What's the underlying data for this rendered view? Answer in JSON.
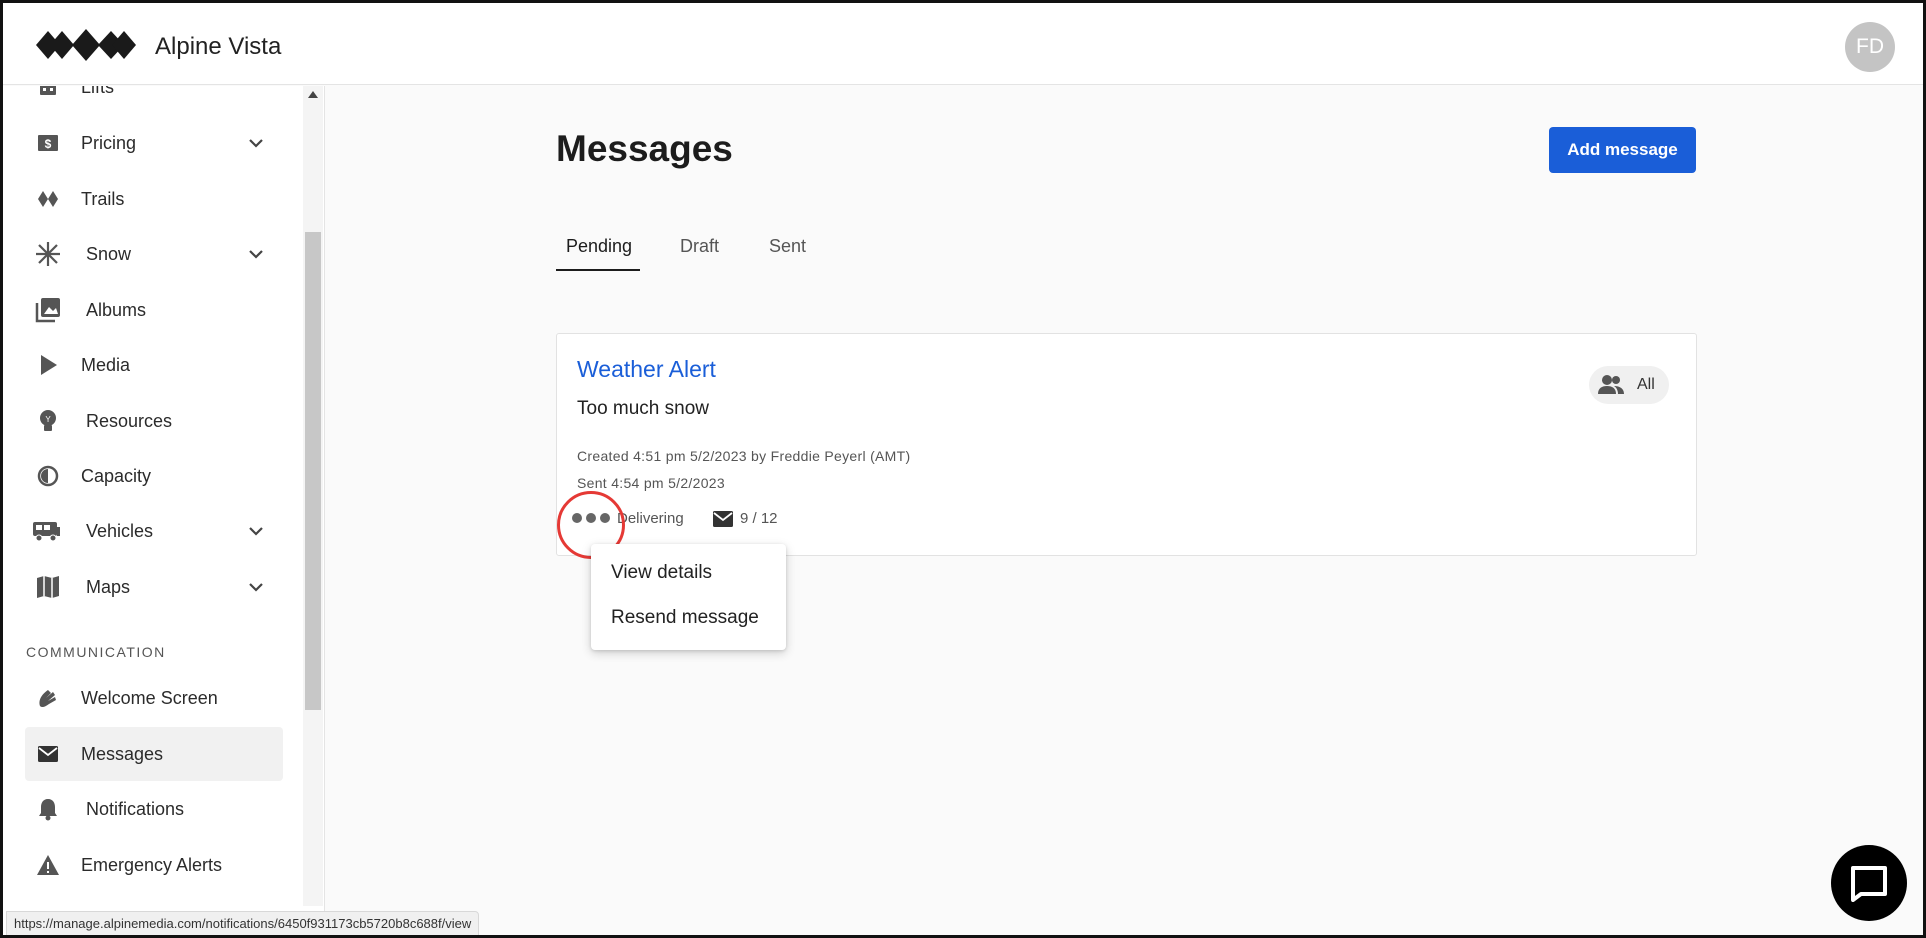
{
  "app": {
    "brand": "Alpine Vista",
    "avatar_initials": "FD"
  },
  "sidebar": {
    "items": [
      {
        "label": "Lifts",
        "icon": "lift-icon"
      },
      {
        "label": "Pricing",
        "icon": "dollar-icon",
        "expandable": true
      },
      {
        "label": "Trails",
        "icon": "trails-icon"
      },
      {
        "label": "Snow",
        "icon": "snowflake-icon",
        "expandable": true
      },
      {
        "label": "Albums",
        "icon": "photo-library-icon"
      },
      {
        "label": "Media",
        "icon": "play-icon"
      },
      {
        "label": "Resources",
        "icon": "lightbulb-icon"
      },
      {
        "label": "Capacity",
        "icon": "gauge-icon"
      },
      {
        "label": "Vehicles",
        "icon": "bus-icon",
        "expandable": true
      },
      {
        "label": "Maps",
        "icon": "map-icon",
        "expandable": true
      }
    ],
    "section_communication": "COMMUNICATION",
    "comm_items": [
      {
        "label": "Welcome Screen",
        "icon": "wave-icon"
      },
      {
        "label": "Messages",
        "icon": "mail-icon",
        "active": true
      },
      {
        "label": "Notifications",
        "icon": "bell-icon"
      },
      {
        "label": "Emergency Alerts",
        "icon": "warning-icon"
      }
    ]
  },
  "main": {
    "title": "Messages",
    "add_button": "Add message",
    "tabs": [
      {
        "label": "Pending",
        "active": true
      },
      {
        "label": "Draft"
      },
      {
        "label": "Sent"
      }
    ],
    "message": {
      "title": "Weather Alert",
      "body": "Too much snow",
      "created": "Created 4:51 pm 5/2/2023 by Freddie Peyerl (AMT)",
      "sent": "Sent 4:54 pm 5/2/2023",
      "status": "Delivering",
      "count": "9 / 12",
      "audience": "All"
    },
    "context_menu": {
      "items": [
        "View details",
        "Resend message"
      ]
    }
  },
  "statusbar": {
    "url": "https://manage.alpinemedia.com/notifications/6450f931173cb5720b8c688f/view"
  },
  "colors": {
    "accent": "#1a5ed8",
    "highlight": "#e53935"
  }
}
